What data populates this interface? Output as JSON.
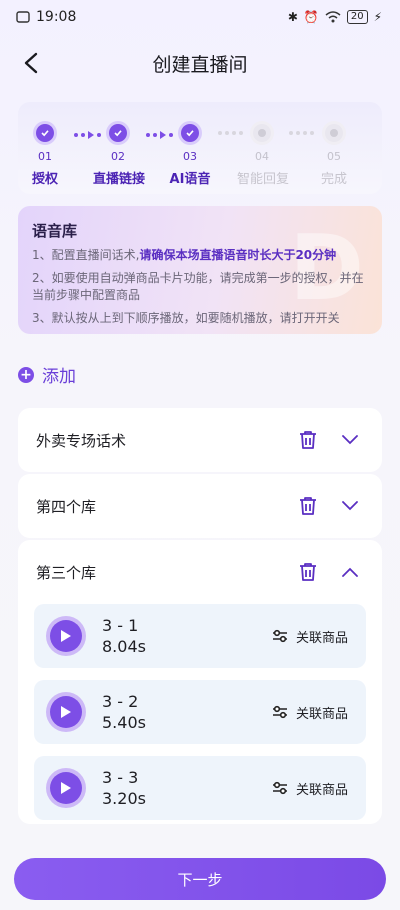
{
  "status_bar": {
    "time": "19:08",
    "battery": "20"
  },
  "nav": {
    "title": "创建直播间"
  },
  "steps": [
    {
      "num": "01",
      "label": "授权",
      "state": "done"
    },
    {
      "num": "02",
      "label": "直播链接",
      "state": "done"
    },
    {
      "num": "03",
      "label": "AI语音",
      "state": "done"
    },
    {
      "num": "04",
      "label": "智能回复",
      "state": "pending"
    },
    {
      "num": "05",
      "label": "完成",
      "state": "pending"
    }
  ],
  "voice_library": {
    "title": "语音库",
    "line1_prefix": "1、配置直播间话术,",
    "line1_highlight": "请确保本场直播语音时长大于20分钟",
    "line2": "2、如要使用自动弹商品卡片功能，请完成第一步的授权，并在当前步骤中配置商品",
    "line3": "3、默认按从上到下顺序播放，如要随机播放，请打开开关"
  },
  "add_label": "添加",
  "libraries": [
    {
      "name": "外卖专场话术",
      "expanded": false
    },
    {
      "name": "第四个库",
      "expanded": false
    },
    {
      "name": "第三个库",
      "expanded": true,
      "items": [
        {
          "name": "3 - 1",
          "duration": "8.04s",
          "link_label": "关联商品"
        },
        {
          "name": "3 - 2",
          "duration": "5.40s",
          "link_label": "关联商品"
        },
        {
          "name": "3 - 3",
          "duration": "3.20s",
          "link_label": "关联商品"
        }
      ]
    }
  ],
  "next_button": "下一步",
  "colors": {
    "accent": "#7d4ee6",
    "accent_light": "#cdb9f7"
  }
}
